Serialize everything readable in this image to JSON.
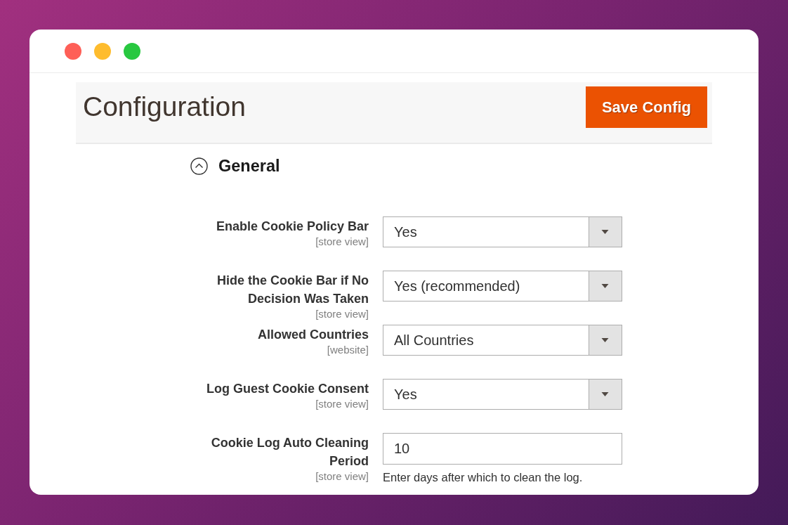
{
  "window": {
    "controls": [
      {
        "color": "#fe5f57"
      },
      {
        "color": "#febc2e"
      },
      {
        "color": "#28c840"
      }
    ]
  },
  "header": {
    "title": "Configuration",
    "button": "Save Config"
  },
  "section": {
    "title": "General",
    "expanded": true,
    "fields": [
      {
        "kind": "select",
        "label": "Enable Cookie Policy Bar",
        "scope": "[store view]",
        "value": "Yes"
      },
      {
        "kind": "select",
        "label": "Hide the Cookie Bar if No Decision Was Taken",
        "scope": "[store view]",
        "value": "Yes (recommended)"
      },
      {
        "kind": "select",
        "label": "Allowed Countries",
        "scope": "[website]",
        "value": "All Countries"
      },
      {
        "kind": "select",
        "label": "Log Guest Cookie Consent",
        "scope": "[store view]",
        "value": "Yes"
      },
      {
        "kind": "text",
        "label": "Cookie Log Auto Cleaning Period",
        "scope": "[store view]",
        "value": "10",
        "note": "Enter days after which to clean the log."
      }
    ]
  }
}
